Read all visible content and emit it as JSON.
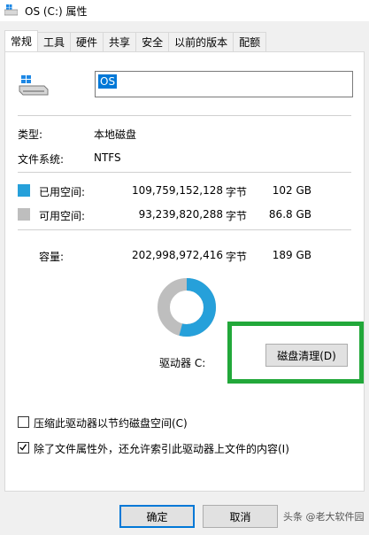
{
  "window": {
    "title": "OS (C:) 属性"
  },
  "tabs": [
    {
      "label": "常规",
      "active": true
    },
    {
      "label": "工具"
    },
    {
      "label": "硬件"
    },
    {
      "label": "共享"
    },
    {
      "label": "安全"
    },
    {
      "label": "以前的版本"
    },
    {
      "label": "配额"
    }
  ],
  "general": {
    "drive_name": "OS",
    "type_label": "类型:",
    "type_value": "本地磁盘",
    "fs_label": "文件系统:",
    "fs_value": "NTFS",
    "used": {
      "label": "已用空间:",
      "bytes": "109,759,152,128",
      "unit": "字节",
      "size": "102 GB",
      "color": "#26a0da"
    },
    "free": {
      "label": "可用空间:",
      "bytes": "93,239,820,288",
      "unit": "字节",
      "size": "86.8 GB",
      "color": "#bebebe"
    },
    "capacity": {
      "label": "容量:",
      "bytes": "202,998,972,416",
      "unit": "字节",
      "size": "189 GB"
    },
    "drive_label": "驱动器 C:",
    "cleanup_button": "磁盘清理(D)",
    "compress_label": "压缩此驱动器以节约磁盘空间(C)",
    "compress_checked": false,
    "index_label": "除了文件属性外，还允许索引此驱动器上文件的内容(I)",
    "index_checked": true,
    "used_fraction": 0.541
  },
  "footer": {
    "ok": "确定",
    "cancel": "取消",
    "watermark": "头条 @老大软件园"
  },
  "colors": {
    "accent": "#0078d7",
    "highlight_frame": "#22a83a"
  }
}
